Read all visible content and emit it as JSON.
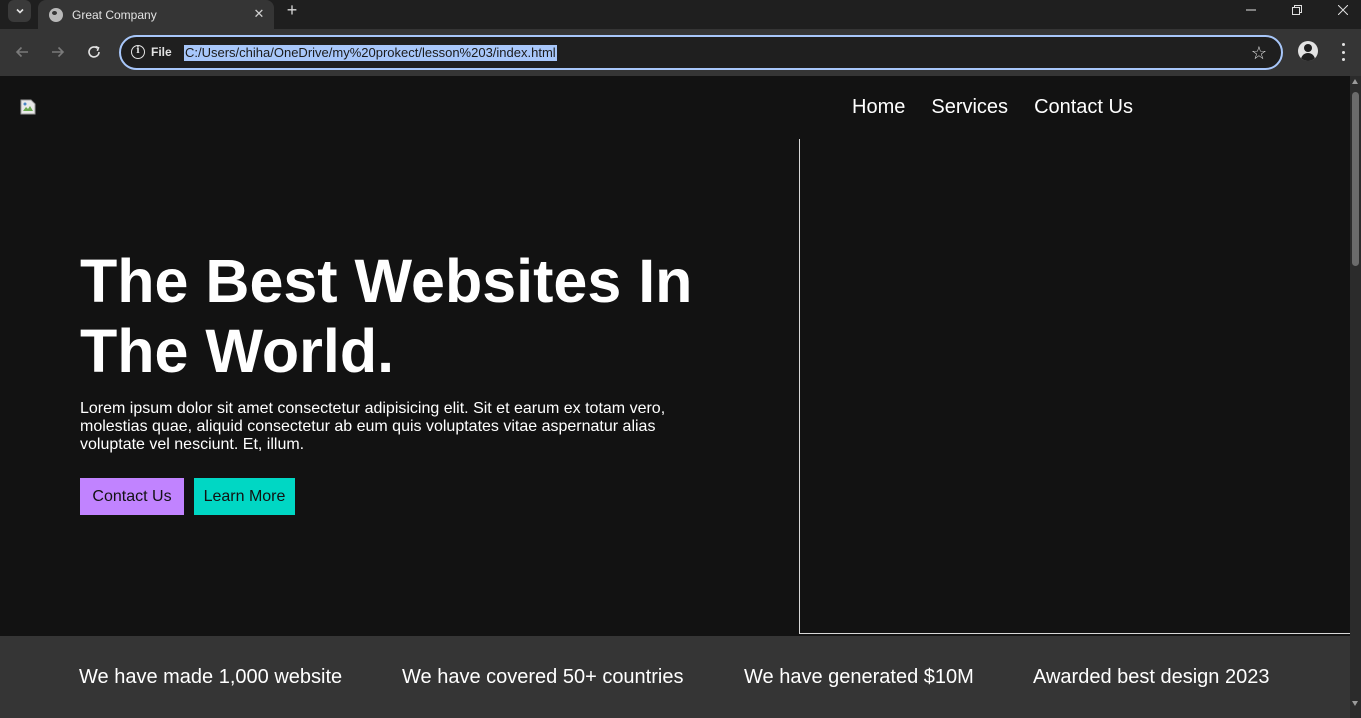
{
  "browser": {
    "tab": {
      "title": "Great Company",
      "favicon_icon": "globe-icon",
      "close_icon": "close-icon"
    },
    "new_tab_icon": "plus-icon",
    "window_controls": [
      "minimize-icon",
      "restore-icon",
      "close-icon"
    ],
    "toolbar": {
      "back_icon": "arrow-left-icon",
      "forward_icon": "arrow-right-icon",
      "reload_icon": "reload-icon",
      "site_info_label": "File",
      "url": "C:/Users/chiha/OneDrive/my%20prokect/lesson%203/index.html",
      "bookmark_icon": "star-icon",
      "profile_icon": "person-icon",
      "menu_icon": "more-vert-icon"
    },
    "accent_color": "#a8c7fa"
  },
  "site": {
    "logo_icon": "broken-image-icon",
    "nav": [
      {
        "label": "Home"
      },
      {
        "label": "Services"
      },
      {
        "label": "Contact Us"
      }
    ],
    "hero": {
      "title": "The Best Websites In The World.",
      "text": "Lorem ipsum dolor sit amet consectetur adipisicing elit. Sit et earum ex totam vero, molestias quae, aliquid consectetur ab eum quis voluptates vitae aspernatur alias voluptate vel nesciunt. Et, illum.",
      "buttons": [
        {
          "label": "Contact Us",
          "color": "#c183ff"
        },
        {
          "label": "Learn More",
          "color": "#00d7c4"
        }
      ]
    },
    "stats": [
      {
        "text": "We have made 1,000 website"
      },
      {
        "text": "We have covered 50+ countries"
      },
      {
        "text": "We have generated $10M"
      },
      {
        "text": "Awarded best design 2023"
      }
    ],
    "background_color": "#121212",
    "stats_background_color": "#353535"
  }
}
